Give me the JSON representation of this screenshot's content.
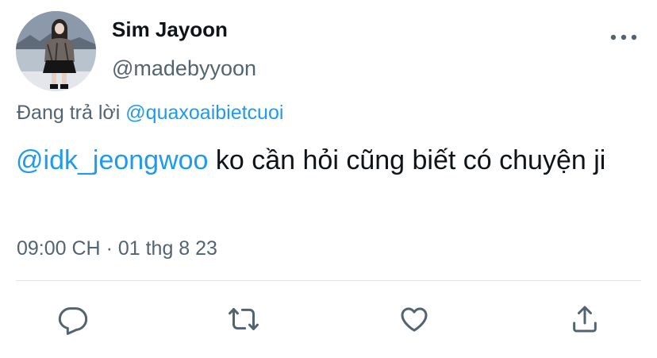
{
  "author": {
    "name": "Sim Jayoon",
    "handle": "@madebyyoon"
  },
  "reply": {
    "prefix": "Đang trả lời",
    "target": "@quaxoaibietcuoi"
  },
  "tweet": {
    "mention": "@idk_jeongwoo",
    "text": " ko cần hỏi cũng biết có chuyện ji",
    "time": "09:00 CH",
    "separator": " · ",
    "date": "01 thg 8 23"
  },
  "icons": {
    "more": "more-horizontal-icon",
    "reply": "reply-icon",
    "retweet": "retweet-icon",
    "like": "heart-icon",
    "share": "share-icon"
  },
  "colors": {
    "link": "#1d9bf0",
    "text": "#0f1419",
    "secondary": "#536471",
    "divider": "#dde3e8"
  }
}
